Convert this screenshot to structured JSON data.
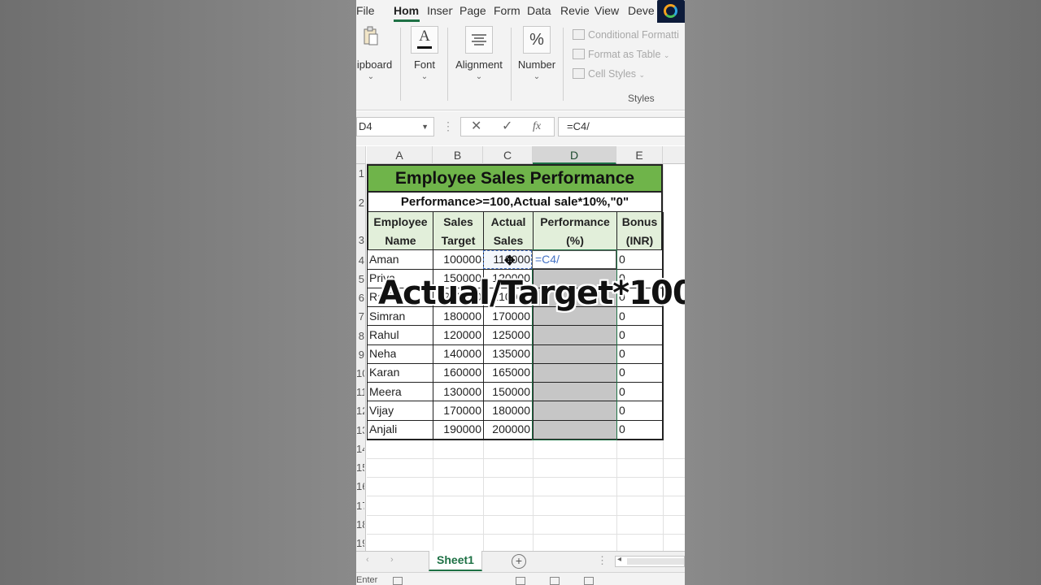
{
  "ribbon": {
    "tabs": [
      "File",
      "Hom",
      "Insert",
      "Page",
      "Form",
      "Data",
      "Revie",
      "View",
      "Deve"
    ],
    "groups": {
      "clipboard": "lipboard",
      "font": "Font",
      "alignment": "Alignment",
      "number": "Number"
    },
    "styles": {
      "conditional": "Conditional Formatti",
      "format_table": "Format as Table",
      "cell_styles": "Cell Styles",
      "group_label": "Styles"
    }
  },
  "formula_bar": {
    "name_box": "D4",
    "formula": "=C4/"
  },
  "columns": [
    "A",
    "B",
    "C",
    "D",
    "E"
  ],
  "sheet": {
    "title": "Employee Sales Performance",
    "subtitle": "Performance>=100,Actual sale*10%,\"0\"",
    "headers": {
      "a": [
        "Employee",
        "Name"
      ],
      "b": [
        "Sales",
        "Target"
      ],
      "c": [
        "Actual",
        "Sales"
      ],
      "d": [
        "Performance",
        "(%)"
      ],
      "e": [
        "Bonus",
        "(INR)"
      ]
    },
    "rows": [
      {
        "name": "Aman",
        "target": "100000",
        "actual": "110000",
        "perf": "=C4/",
        "bonus": "0"
      },
      {
        "name": "Priya",
        "target": "150000",
        "actual": "120000",
        "perf": "",
        "bonus": "0"
      },
      {
        "name": "Ravi",
        "target": "200000",
        "actual": "210000",
        "perf": "",
        "bonus": "0"
      },
      {
        "name": "Simran",
        "target": "180000",
        "actual": "170000",
        "perf": "",
        "bonus": "0"
      },
      {
        "name": "Rahul",
        "target": "120000",
        "actual": "125000",
        "perf": "",
        "bonus": "0"
      },
      {
        "name": "Neha",
        "target": "140000",
        "actual": "135000",
        "perf": "",
        "bonus": "0"
      },
      {
        "name": "Karan",
        "target": "160000",
        "actual": "165000",
        "perf": "",
        "bonus": "0"
      },
      {
        "name": "Meera",
        "target": "130000",
        "actual": "150000",
        "perf": "",
        "bonus": "0"
      },
      {
        "name": "Vijay",
        "target": "170000",
        "actual": "180000",
        "perf": "",
        "bonus": "0"
      },
      {
        "name": "Anjali",
        "target": "190000",
        "actual": "200000",
        "perf": "",
        "bonus": "0"
      }
    ],
    "row_numbers": [
      "1",
      "2",
      "3",
      "4",
      "5",
      "6",
      "7",
      "8",
      "9",
      "10",
      "11",
      "12",
      "13",
      "14",
      "15",
      "16",
      "17",
      "18",
      "19"
    ]
  },
  "overlay": "Actual/Target*100",
  "sheet_tab": "Sheet1",
  "status": "Enter"
}
